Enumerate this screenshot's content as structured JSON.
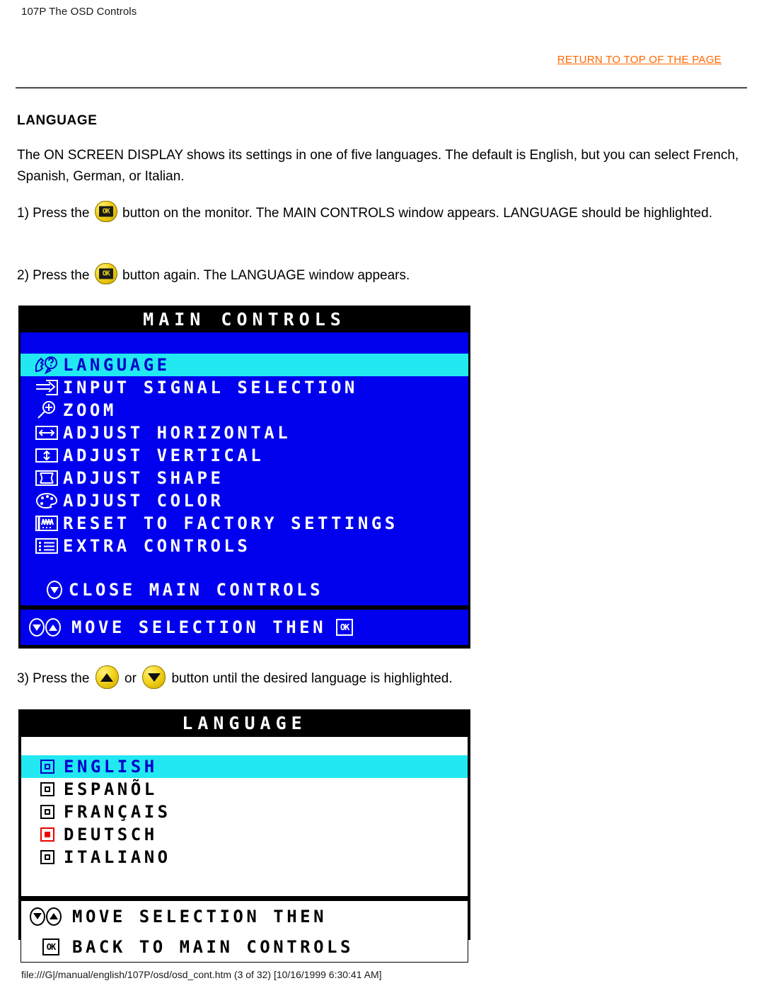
{
  "header": {
    "breadcrumb": "107P The OSD Controls",
    "return_link": "RETURN TO TOP OF THE PAGE"
  },
  "colors": {
    "link": "#ff6600",
    "osd_blue": "#0000ee",
    "osd_highlight": "#22e8f2",
    "osd_selected_text": "#0000cc",
    "button_yellow": "#f2d21a",
    "radio_selected": "#ee0000"
  },
  "content": {
    "section_title": "LANGUAGE",
    "intro": "The ON SCREEN DISPLAY shows its settings in one of five languages. The default is English, but you can select French, Spanish, German, or Italian.",
    "step1_a": "1) Press the",
    "step1_b": "button on the monitor. The MAIN CONTROLS window appears. LANGUAGE should be highlighted.",
    "step2_a": "2) Press the",
    "step2_b": "button again. The LANGUAGE window appears.",
    "step3_a": "3) Press the",
    "step3_or": "or",
    "step3_b": "button until the desired language is highlighted."
  },
  "osd_main": {
    "title": "MAIN CONTROLS",
    "items": [
      {
        "label": "LANGUAGE",
        "icon": "head-question-icon",
        "selected": true
      },
      {
        "label": "INPUT SIGNAL SELECTION",
        "icon": "input-arrow-icon",
        "selected": false
      },
      {
        "label": "ZOOM",
        "icon": "magnifier-plus-icon",
        "selected": false
      },
      {
        "label": "ADJUST HORIZONTAL",
        "icon": "arrows-horizontal-icon",
        "selected": false
      },
      {
        "label": "ADJUST VERTICAL",
        "icon": "arrows-vertical-icon",
        "selected": false
      },
      {
        "label": "ADJUST SHAPE",
        "icon": "shape-frame-icon",
        "selected": false
      },
      {
        "label": "ADJUST COLOR",
        "icon": "color-palette-icon",
        "selected": false
      },
      {
        "label": "RESET TO FACTORY SETTINGS",
        "icon": "reset-waveform-icon",
        "selected": false
      },
      {
        "label": "EXTRA CONTROLS",
        "icon": "list-lines-icon",
        "selected": false
      }
    ],
    "close_label": "CLOSE MAIN CONTROLS",
    "footer_label": "MOVE SELECTION THEN",
    "footer_ok": "OK"
  },
  "osd_language": {
    "title": "LANGUAGE",
    "options": [
      {
        "label": "ENGLISH",
        "highlighted": true,
        "marked": false
      },
      {
        "label": "ESPANÕL",
        "highlighted": false,
        "marked": false
      },
      {
        "label": "FRANÇAIS",
        "highlighted": false,
        "marked": false
      },
      {
        "label": "DEUTSCH",
        "highlighted": false,
        "marked": true
      },
      {
        "label": "ITALIANO",
        "highlighted": false,
        "marked": false
      }
    ],
    "footer_line1": "MOVE SELECTION THEN",
    "footer_line2": "BACK TO MAIN CONTROLS",
    "footer_ok": "OK"
  },
  "footer": {
    "path": "file:///G|/manual/english/107P/osd/osd_cont.htm (3 of 32) [10/16/1999 6:30:41 AM]"
  }
}
